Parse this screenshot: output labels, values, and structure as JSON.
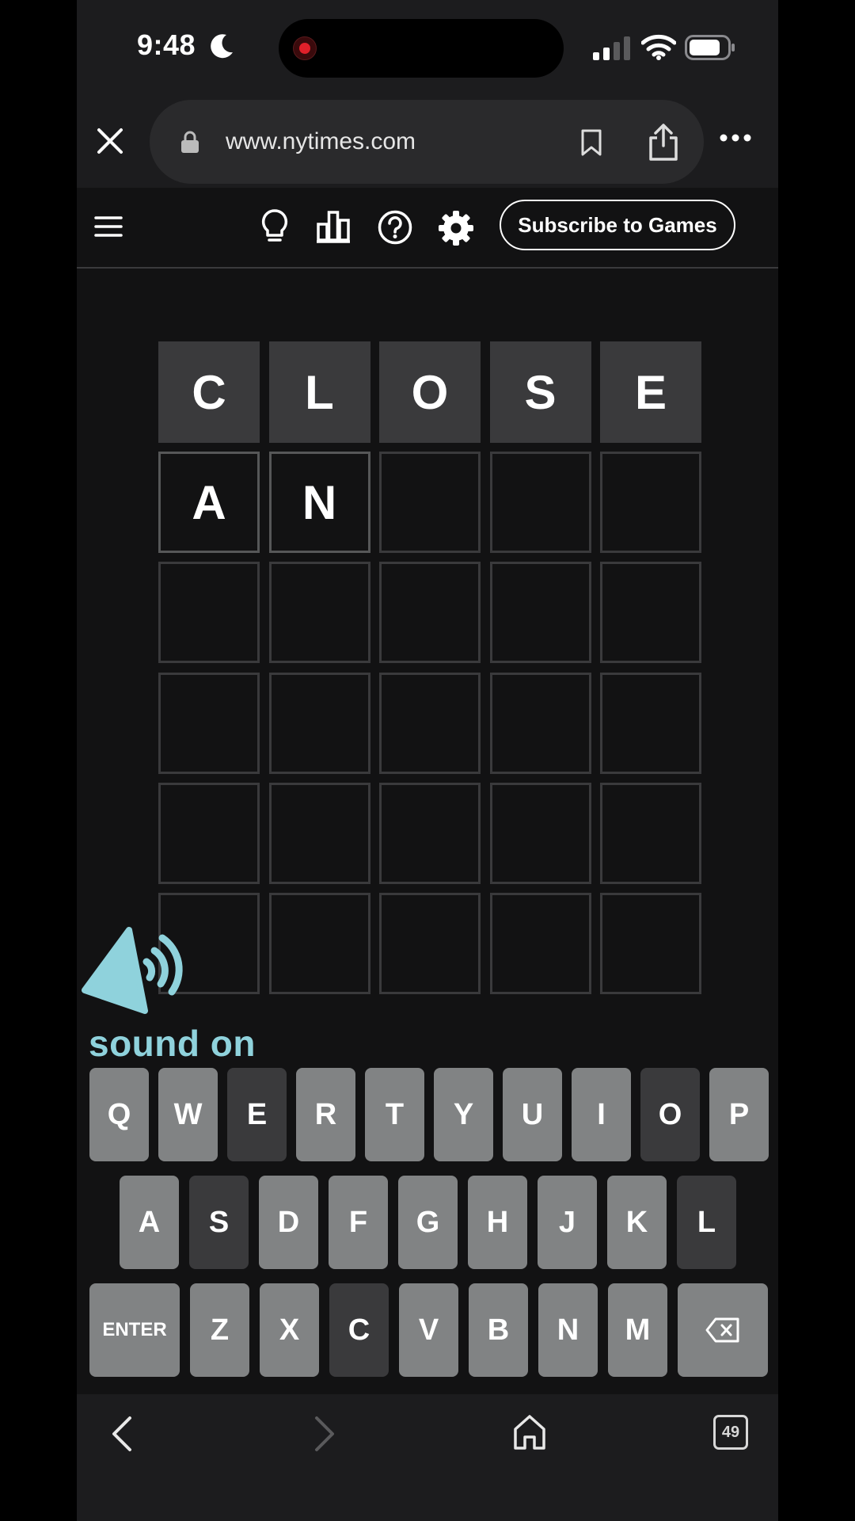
{
  "status_bar": {
    "time": "9:48"
  },
  "browser": {
    "url": "www.nytimes.com"
  },
  "game_header": {
    "subscribe_label": "Subscribe to Games"
  },
  "board": {
    "rows": [
      {
        "tiles": [
          {
            "letter": "C",
            "state": "absent"
          },
          {
            "letter": "L",
            "state": "absent"
          },
          {
            "letter": "O",
            "state": "absent"
          },
          {
            "letter": "S",
            "state": "absent"
          },
          {
            "letter": "E",
            "state": "absent"
          }
        ]
      },
      {
        "tiles": [
          {
            "letter": "A",
            "state": "filled"
          },
          {
            "letter": "N",
            "state": "filled"
          },
          {
            "letter": "",
            "state": "empty"
          },
          {
            "letter": "",
            "state": "empty"
          },
          {
            "letter": "",
            "state": "empty"
          }
        ]
      },
      {
        "tiles": [
          {
            "letter": "",
            "state": "empty"
          },
          {
            "letter": "",
            "state": "empty"
          },
          {
            "letter": "",
            "state": "empty"
          },
          {
            "letter": "",
            "state": "empty"
          },
          {
            "letter": "",
            "state": "empty"
          }
        ]
      },
      {
        "tiles": [
          {
            "letter": "",
            "state": "empty"
          },
          {
            "letter": "",
            "state": "empty"
          },
          {
            "letter": "",
            "state": "empty"
          },
          {
            "letter": "",
            "state": "empty"
          },
          {
            "letter": "",
            "state": "empty"
          }
        ]
      },
      {
        "tiles": [
          {
            "letter": "",
            "state": "empty"
          },
          {
            "letter": "",
            "state": "empty"
          },
          {
            "letter": "",
            "state": "empty"
          },
          {
            "letter": "",
            "state": "empty"
          },
          {
            "letter": "",
            "state": "empty"
          }
        ]
      },
      {
        "tiles": [
          {
            "letter": "",
            "state": "empty"
          },
          {
            "letter": "",
            "state": "empty"
          },
          {
            "letter": "",
            "state": "empty"
          },
          {
            "letter": "",
            "state": "empty"
          },
          {
            "letter": "",
            "state": "empty"
          }
        ]
      }
    ]
  },
  "sound_overlay": {
    "label": "sound on"
  },
  "keyboard": {
    "rows": [
      [
        {
          "key": "Q",
          "state": "unused"
        },
        {
          "key": "W",
          "state": "unused"
        },
        {
          "key": "E",
          "state": "absent"
        },
        {
          "key": "R",
          "state": "unused"
        },
        {
          "key": "T",
          "state": "unused"
        },
        {
          "key": "Y",
          "state": "unused"
        },
        {
          "key": "U",
          "state": "unused"
        },
        {
          "key": "I",
          "state": "unused"
        },
        {
          "key": "O",
          "state": "absent"
        },
        {
          "key": "P",
          "state": "unused"
        }
      ],
      [
        {
          "key": "A",
          "state": "unused"
        },
        {
          "key": "S",
          "state": "absent"
        },
        {
          "key": "D",
          "state": "unused"
        },
        {
          "key": "F",
          "state": "unused"
        },
        {
          "key": "G",
          "state": "unused"
        },
        {
          "key": "H",
          "state": "unused"
        },
        {
          "key": "J",
          "state": "unused"
        },
        {
          "key": "K",
          "state": "unused"
        },
        {
          "key": "L",
          "state": "absent"
        }
      ],
      [
        {
          "key": "ENTER",
          "state": "unused"
        },
        {
          "key": "Z",
          "state": "unused"
        },
        {
          "key": "X",
          "state": "unused"
        },
        {
          "key": "C",
          "state": "absent"
        },
        {
          "key": "V",
          "state": "unused"
        },
        {
          "key": "B",
          "state": "unused"
        },
        {
          "key": "N",
          "state": "unused"
        },
        {
          "key": "M",
          "state": "unused"
        },
        {
          "key": "",
          "state": "unused",
          "icon": "backspace-icon"
        }
      ]
    ]
  },
  "toolbar": {
    "tab_count": "49"
  },
  "colors": {
    "background": "#121213",
    "absent": "#3a3a3c",
    "key_unused": "#818384",
    "sound_accent": "#8fd2dc"
  }
}
